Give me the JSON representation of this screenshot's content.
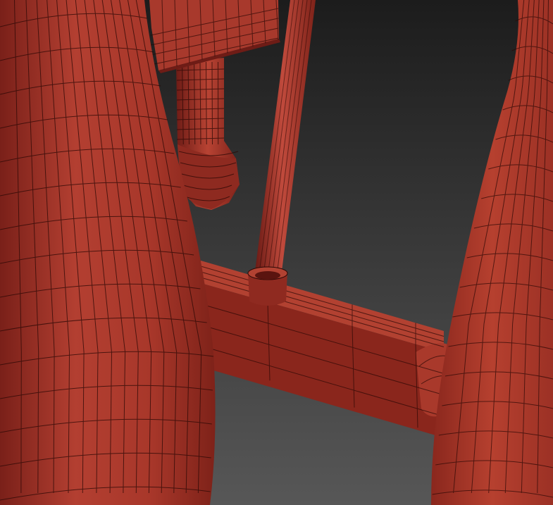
{
  "scene": {
    "subject": "wireframe-shaded-3d-model",
    "colors": {
      "background_top": "#1c1c1c",
      "background_bottom": "#575757",
      "mesh_fill": "#9a3026",
      "mesh_light": "#c04a3c",
      "mesh_dark": "#6e1c16",
      "wire": "#2a0805"
    }
  }
}
